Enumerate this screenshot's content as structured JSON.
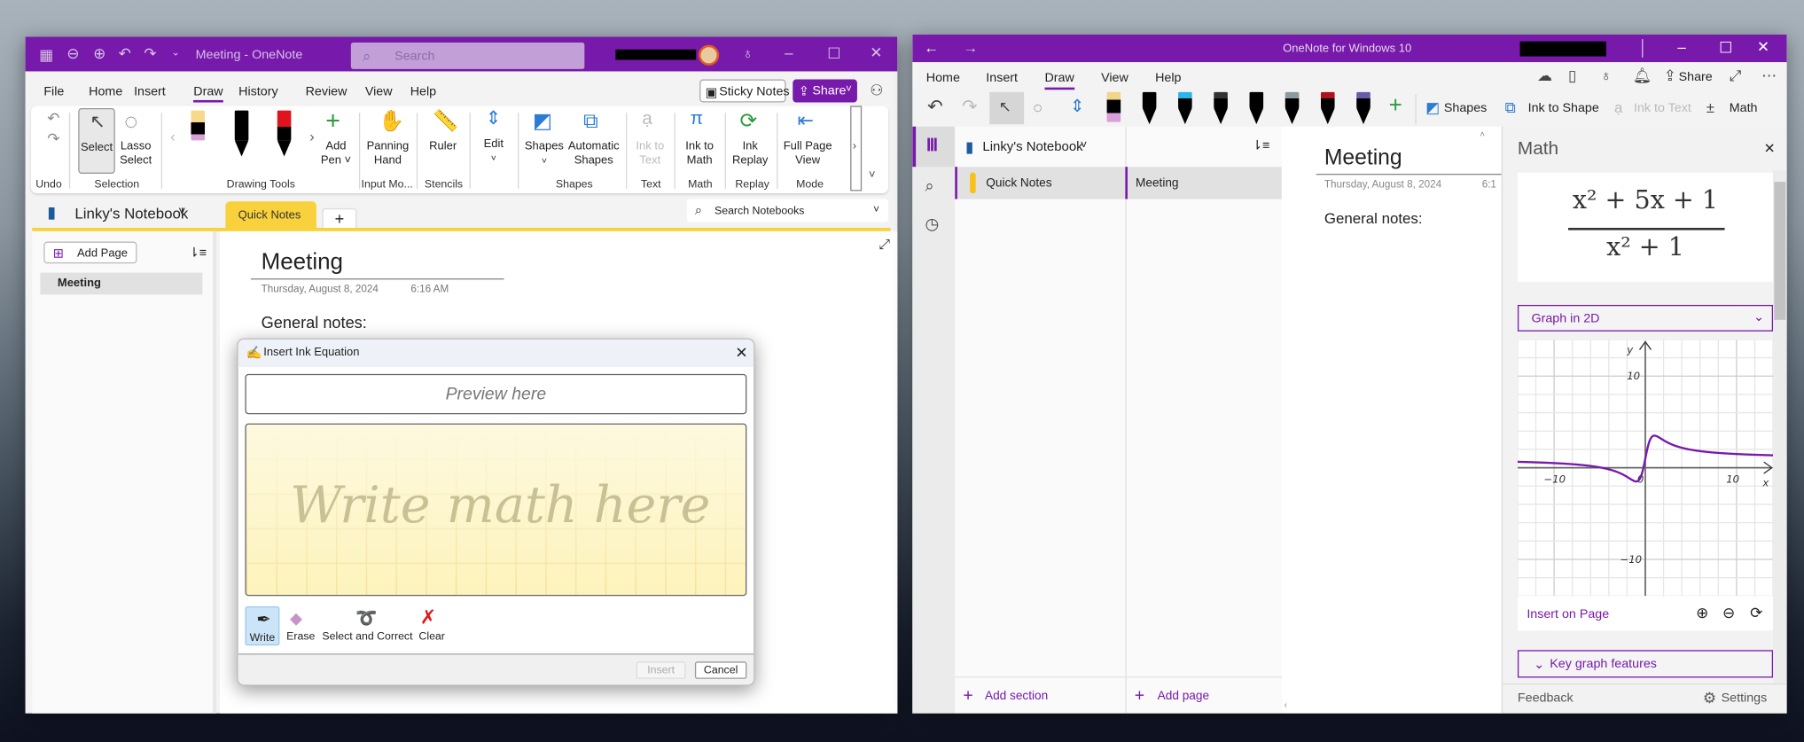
{
  "left_window": {
    "title": "Meeting  -  OneNote",
    "search_placeholder": "Search",
    "menu": [
      "File",
      "Home",
      "Insert",
      "Draw",
      "History",
      "Review",
      "View",
      "Help"
    ],
    "active_menu": "Draw",
    "sticky_notes": "Sticky Notes",
    "share": "Share",
    "ribbon": {
      "select": "Select",
      "lasso": [
        "Lasso",
        "Select"
      ],
      "add_pen": [
        "Add",
        "Pen ˅"
      ],
      "panning_hand": [
        "Panning",
        "Hand"
      ],
      "ruler": "Ruler",
      "edit": "Edit",
      "shapes": "Shapes",
      "automatic_shapes": [
        "Automatic",
        "Shapes"
      ],
      "ink_to_text": [
        "Ink to",
        "Text"
      ],
      "ink_to_math": [
        "Ink to",
        "Math"
      ],
      "ink_replay": [
        "Ink",
        "Replay"
      ],
      "full_page_view": [
        "Full Page",
        "View"
      ],
      "groups": [
        "Undo",
        "Selection",
        "Drawing Tools",
        "Input Mo...",
        "Stencils",
        "Shapes",
        "Text",
        "Math",
        "Replay",
        "Mode"
      ]
    },
    "notebook": "Linky's Notebook",
    "section_tab": "Quick Notes",
    "add_tab": "+",
    "search_notebooks": "Search Notebooks",
    "add_page": "Add Page",
    "pages": [
      "Meeting"
    ],
    "page": {
      "title": "Meeting",
      "date": "Thursday, August 8, 2024",
      "time": "6:16 AM",
      "body": "General notes:"
    }
  },
  "dialog": {
    "title": "Insert Ink Equation",
    "preview": "Preview here",
    "canvas_hint": "Write math here",
    "tools": [
      "Write",
      "Erase",
      "Select and Correct",
      "Clear"
    ],
    "insert": "Insert",
    "cancel": "Cancel"
  },
  "right_window": {
    "title": "OneNote for Windows 10",
    "tabs": [
      "Home",
      "Insert",
      "Draw",
      "View",
      "Help"
    ],
    "active_tab": "Draw",
    "share": "Share",
    "toolbar": {
      "shapes": "Shapes",
      "ink_to_shape": "Ink to Shape",
      "ink_to_text": "Ink to Text",
      "math": "Math"
    },
    "pen_colors": [
      "#f3d58a",
      "#000000",
      "#2bb5e8",
      "#333333",
      "#000000",
      "#8a9aa0",
      "#b0121b",
      "#6a5aa8"
    ],
    "notebook": "Linky's Notebook",
    "sections": [
      "Quick Notes"
    ],
    "pages": [
      "Meeting"
    ],
    "add_section": "Add section",
    "add_page": "Add page",
    "page": {
      "title": "Meeting",
      "date": "Thursday, August 8, 2024",
      "time": "6:1",
      "body": "General notes:"
    },
    "math": {
      "title": "Math",
      "numerator": "x² + 5x + 1",
      "denominator": "x² + 1",
      "mode": "Graph in 2D",
      "insert_on_page": "Insert on Page",
      "key_features": "Key graph features",
      "feedback": "Feedback",
      "settings": "Settings"
    }
  },
  "chart_data": {
    "type": "line",
    "title": "",
    "function": "(x^2+5x+1)/(x^2+1)",
    "numerator_coeffs": [
      1,
      5,
      1
    ],
    "denominator_coeffs": [
      1,
      0,
      1
    ],
    "xlabel": "x",
    "ylabel": "y",
    "xlim": [
      -14,
      14
    ],
    "ylim": [
      -14,
      14
    ],
    "grid_step": 2,
    "x_ticks": [
      {
        "v": -10,
        "label": "−10"
      },
      {
        "v": 0,
        "label": "0"
      },
      {
        "v": 10,
        "label": "10"
      }
    ],
    "y_ticks": [
      {
        "v": 10,
        "label": "10"
      },
      {
        "v": -10,
        "label": "−10"
      }
    ],
    "line_color": "#7719aa"
  },
  "colors": {
    "accent": "#7719aa",
    "section_yellow": "#f8d13c"
  }
}
